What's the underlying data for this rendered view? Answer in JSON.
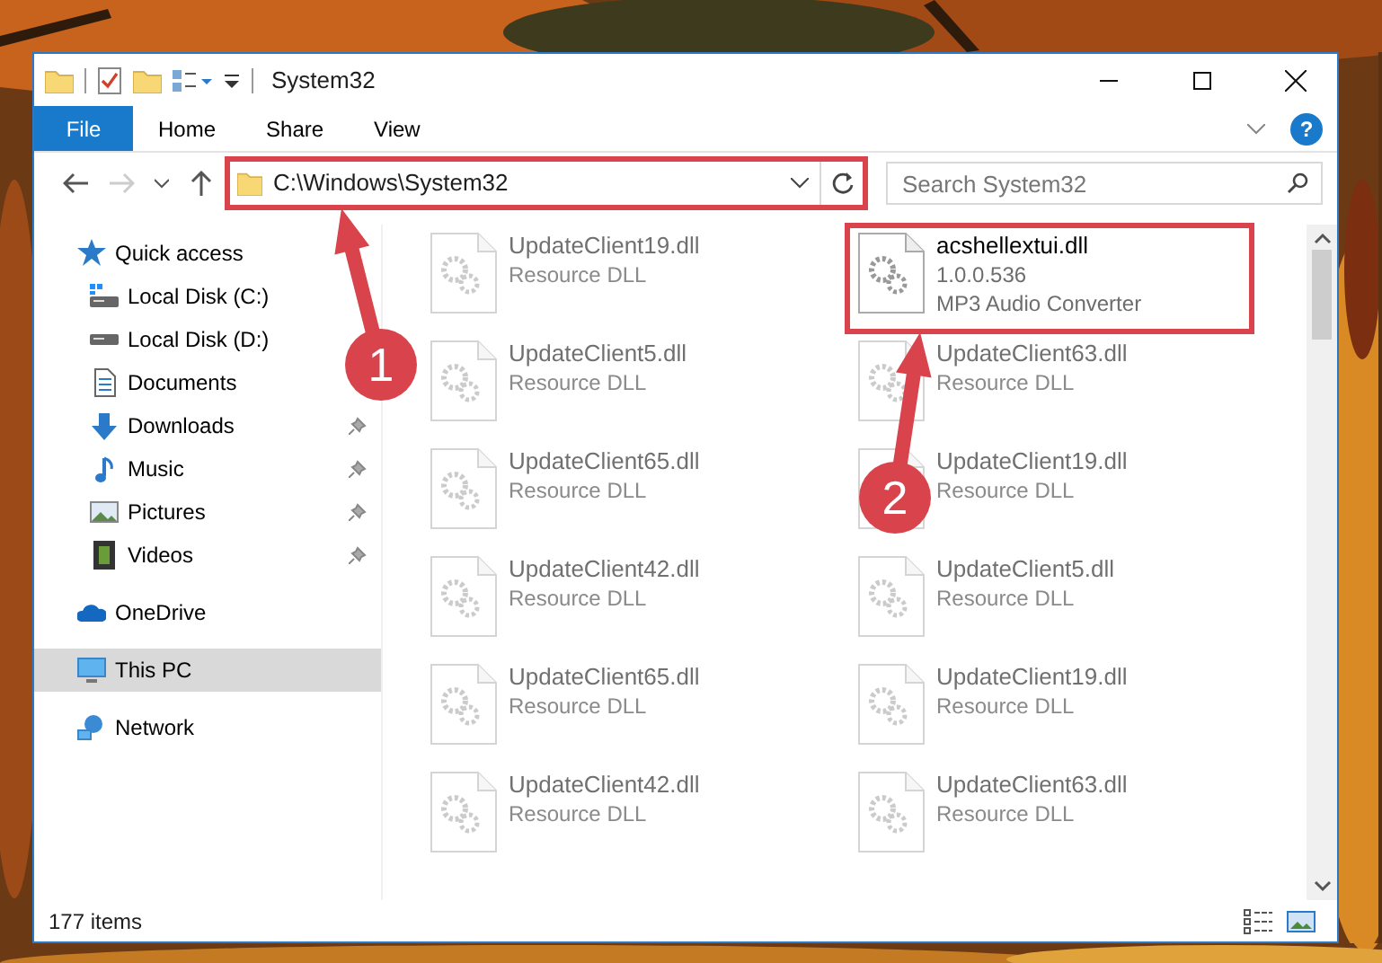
{
  "window": {
    "title": "System32"
  },
  "ribbon": {
    "tabs": [
      {
        "label": "File",
        "kind": "file"
      },
      {
        "label": "Home",
        "kind": "tab"
      },
      {
        "label": "Share",
        "kind": "tab"
      },
      {
        "label": "View",
        "kind": "tab"
      }
    ],
    "help": "?"
  },
  "address_bar": {
    "path": "C:\\Windows\\System32",
    "highlighted": true
  },
  "search": {
    "placeholder": "Search System32"
  },
  "navigation": [
    {
      "label": "Quick access",
      "kind": "star",
      "selected": false,
      "children": [
        {
          "label": "Local Disk (C:)",
          "kind": "drive-c",
          "pinned": false,
          "selected": false
        },
        {
          "label": "Local Disk (D:)",
          "kind": "drive",
          "pinned": false,
          "selected": false
        },
        {
          "label": "Documents",
          "kind": "documents",
          "pinned": false,
          "selected": false
        },
        {
          "label": "Downloads",
          "kind": "downloads",
          "pinned": true,
          "selected": false
        },
        {
          "label": "Music",
          "kind": "music",
          "pinned": true,
          "selected": false
        },
        {
          "label": "Pictures",
          "kind": "pictures",
          "pinned": true,
          "selected": false
        },
        {
          "label": "Videos",
          "kind": "videos",
          "pinned": true,
          "selected": false
        }
      ]
    },
    {
      "label": "OneDrive",
      "kind": "cloud",
      "selected": false
    },
    {
      "label": "This PC",
      "kind": "pc",
      "selected": true
    },
    {
      "label": "Network",
      "kind": "network",
      "selected": false
    }
  ],
  "files": [
    {
      "name": "UpdateClient19.dll",
      "details": [
        "Resource DLL"
      ],
      "blurred": true,
      "highlighted": false
    },
    {
      "name": "acshellextui.dll",
      "details": [
        "1.0.0.536",
        "MP3 Audio Converter"
      ],
      "blurred": false,
      "highlighted": true
    },
    {
      "name": "UpdateClient5.dll",
      "details": [
        "Resource DLL"
      ],
      "blurred": true,
      "highlighted": false
    },
    {
      "name": "UpdateClient63.dll",
      "details": [
        "Resource DLL"
      ],
      "blurred": true,
      "highlighted": false
    },
    {
      "name": "UpdateClient65.dll",
      "details": [
        "Resource DLL"
      ],
      "blurred": true,
      "highlighted": false
    },
    {
      "name": "UpdateClient19.dll",
      "details": [
        "Resource DLL"
      ],
      "blurred": true,
      "highlighted": false
    },
    {
      "name": "UpdateClient42.dll",
      "details": [
        "Resource DLL"
      ],
      "blurred": true,
      "highlighted": false
    },
    {
      "name": "UpdateClient5.dll",
      "details": [
        "Resource DLL"
      ],
      "blurred": true,
      "highlighted": false
    },
    {
      "name": "UpdateClient65.dll",
      "details": [
        "Resource DLL"
      ],
      "blurred": true,
      "highlighted": false
    },
    {
      "name": "UpdateClient19.dll",
      "details": [
        "Resource DLL"
      ],
      "blurred": true,
      "highlighted": false
    },
    {
      "name": "UpdateClient42.dll",
      "details": [
        "Resource DLL"
      ],
      "blurred": true,
      "highlighted": false
    },
    {
      "name": "UpdateClient63.dll",
      "details": [
        "Resource DLL"
      ],
      "blurred": true,
      "highlighted": false
    }
  ],
  "status_bar": {
    "item_count": "177 items"
  },
  "annotations": [
    {
      "number": "1"
    },
    {
      "number": "2"
    }
  ]
}
